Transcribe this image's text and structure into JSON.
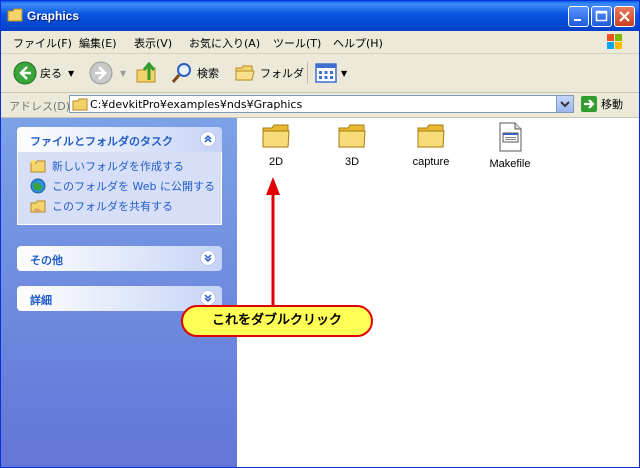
{
  "window": {
    "title": "Graphics"
  },
  "menu": {
    "items": [
      "ファイル(F)",
      "編集(E)",
      "表示(V)",
      "お気に入り(A)",
      "ツール(T)",
      "ヘルプ(H)"
    ]
  },
  "toolbar": {
    "back_label": "戻る",
    "search_label": "検索",
    "folders_label": "フォルダ"
  },
  "address": {
    "label": "アドレス(D)",
    "path": "C:¥devkitPro¥examples¥nds¥Graphics",
    "go_label": "移動"
  },
  "left_panel": {
    "tasks_title": "ファイルとフォルダのタスク",
    "tasks": [
      "新しいフォルダを作成する",
      "このフォルダを Web に公開する",
      "このフォルダを共有する"
    ],
    "other_title": "その他",
    "details_title": "詳細"
  },
  "files": [
    {
      "name": "2D",
      "type": "folder"
    },
    {
      "name": "3D",
      "type": "folder"
    },
    {
      "name": "capture",
      "type": "folder"
    },
    {
      "name": "Makefile",
      "type": "file"
    }
  ],
  "callout": {
    "text": "これをダブルクリック"
  },
  "colors": {
    "titlebar": "#0a54e0",
    "panel": "#6f8fdf",
    "link": "#215dc6",
    "callout_fill": "#ffff55",
    "callout_border": "#e00000"
  }
}
